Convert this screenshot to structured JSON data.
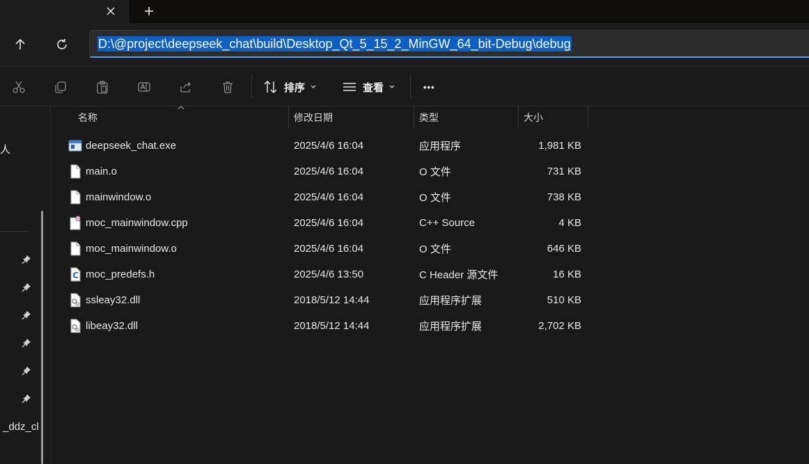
{
  "tab": {
    "close_icon": "close-icon",
    "new_icon": "plus-icon"
  },
  "nav": {
    "up_icon": "arrow-up-icon",
    "refresh_icon": "refresh-icon",
    "address": "D:\\@project\\deepseek_chat\\build\\Desktop_Qt_5_15_2_MinGW_64_bit-Debug\\debug"
  },
  "toolbar": {
    "sort_label": "排序",
    "view_label": "查看",
    "more_label": "•••"
  },
  "sidebar": {
    "partial_top": "人",
    "partial_bottom": "_ddz_cl"
  },
  "columns": {
    "name": "名称",
    "modified": "修改日期",
    "type": "类型",
    "size": "大小"
  },
  "files": [
    {
      "name": "deepseek_chat.exe",
      "modified": "2025/4/6 16:04",
      "type": "应用程序",
      "size": "1,981 KB",
      "icon": "exe"
    },
    {
      "name": "main.o",
      "modified": "2025/4/6 16:04",
      "type": "O 文件",
      "size": "731 KB",
      "icon": "file"
    },
    {
      "name": "mainwindow.o",
      "modified": "2025/4/6 16:04",
      "type": "O 文件",
      "size": "738 KB",
      "icon": "file"
    },
    {
      "name": "moc_mainwindow.cpp",
      "modified": "2025/4/6 16:04",
      "type": "C++ Source",
      "size": "4 KB",
      "icon": "cpp"
    },
    {
      "name": "moc_mainwindow.o",
      "modified": "2025/4/6 16:04",
      "type": "O 文件",
      "size": "646 KB",
      "icon": "file"
    },
    {
      "name": "moc_predefs.h",
      "modified": "2025/4/6 13:50",
      "type": "C Header 源文件",
      "size": "16 KB",
      "icon": "header"
    },
    {
      "name": "ssleay32.dll",
      "modified": "2018/5/12 14:44",
      "type": "应用程序扩展",
      "size": "510 KB",
      "icon": "dll"
    },
    {
      "name": "libeay32.dll",
      "modified": "2018/5/12 14:44",
      "type": "应用程序扩展",
      "size": "2,702 KB",
      "icon": "dll"
    }
  ],
  "colors": {
    "selection": "#0d5fc2",
    "accent": "#4aa0f0"
  }
}
